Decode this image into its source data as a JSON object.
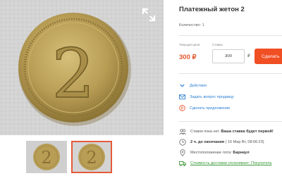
{
  "lot": {
    "title": "Платежный жетон 2",
    "quantity": "Количество: 1"
  },
  "price": {
    "start_label": "Текущая цена",
    "bid_label": "Ставка",
    "start_value": "300 ₽",
    "bid_value": "300",
    "currency": "₽",
    "bid_button": "Сделать"
  },
  "actions": [
    {
      "label": "Действия",
      "icon": "chevron-down-icon"
    },
    {
      "label": "Задать вопрос продавцу",
      "icon": "mail-icon"
    },
    {
      "label": "Сделать предложение",
      "icon": "offer-icon"
    }
  ],
  "info": {
    "bids_prefix": "Ставок пока нет.",
    "bids_bold": "Ваша ставка будет первой!",
    "time_bold": "2 ч. до окончания",
    "time_rest": "( 16 Мар Вт, 08:06:23)",
    "location_label": "Местоположение лота:",
    "location_value": "Барнаул",
    "delivery": "Стоимость доставки оплачивает: Покупатель"
  },
  "colors": {
    "accent": "#f04e23",
    "price": "#e4572e",
    "link": "#2a7fd4",
    "green": "#3a9a3a"
  },
  "icons": [
    "expand-icon",
    "user-group-icon",
    "clock-icon",
    "location-pin-icon",
    "truck-icon"
  ],
  "coin_digit": "2"
}
